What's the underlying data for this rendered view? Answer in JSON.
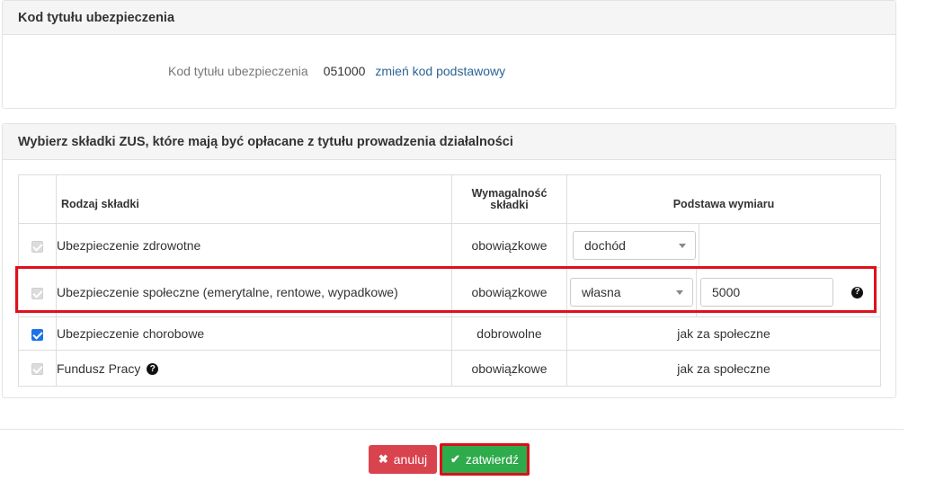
{
  "section1": {
    "title": "Kod tytułu ubezpieczenia",
    "label": "Kod tytułu ubezpieczenia",
    "value": "051000",
    "link": "zmień kod podstawowy"
  },
  "section2": {
    "title": "Wybierz składki ZUS, które mają być opłacane z tytułu prowadzenia działalności",
    "headers": {
      "rodzaj": "Rodzaj składki",
      "wymagalnosc_line1": "Wymagalność",
      "wymagalnosc_line2": "składki",
      "podstawa": "Podstawa wymiaru"
    },
    "rows": [
      {
        "name": "Ubezpieczenie zdrowotne",
        "wymagalnosc": "obowiązkowe",
        "select": "dochód",
        "checked": true,
        "disabled": true
      },
      {
        "name": "Ubezpieczenie społeczne (emerytalne, rentowe, wypadkowe)",
        "wymagalnosc": "obowiązkowe",
        "select": "własna",
        "input": "5000",
        "checked": true,
        "disabled": true
      },
      {
        "name": "Ubezpieczenie chorobowe",
        "wymagalnosc": "dobrowolne",
        "podstawa": "jak za społeczne",
        "checked": true,
        "disabled": false
      },
      {
        "name": "Fundusz Pracy",
        "wymagalnosc": "obowiązkowe",
        "podstawa": "jak za społeczne",
        "checked": true,
        "disabled": true
      }
    ]
  },
  "buttons": {
    "cancel": "anuluj",
    "confirm": "zatwierdź"
  },
  "colors": {
    "cancel_bg": "#d9434e",
    "confirm_bg": "#2eab4a",
    "link": "#2a6496",
    "highlight": "#e0101c",
    "checkbox": "#1a73e8"
  },
  "icons": {
    "help": "question-circle-icon",
    "cancel": "times-icon",
    "confirm": "check-icon",
    "dropdown": "caret-down-icon"
  }
}
